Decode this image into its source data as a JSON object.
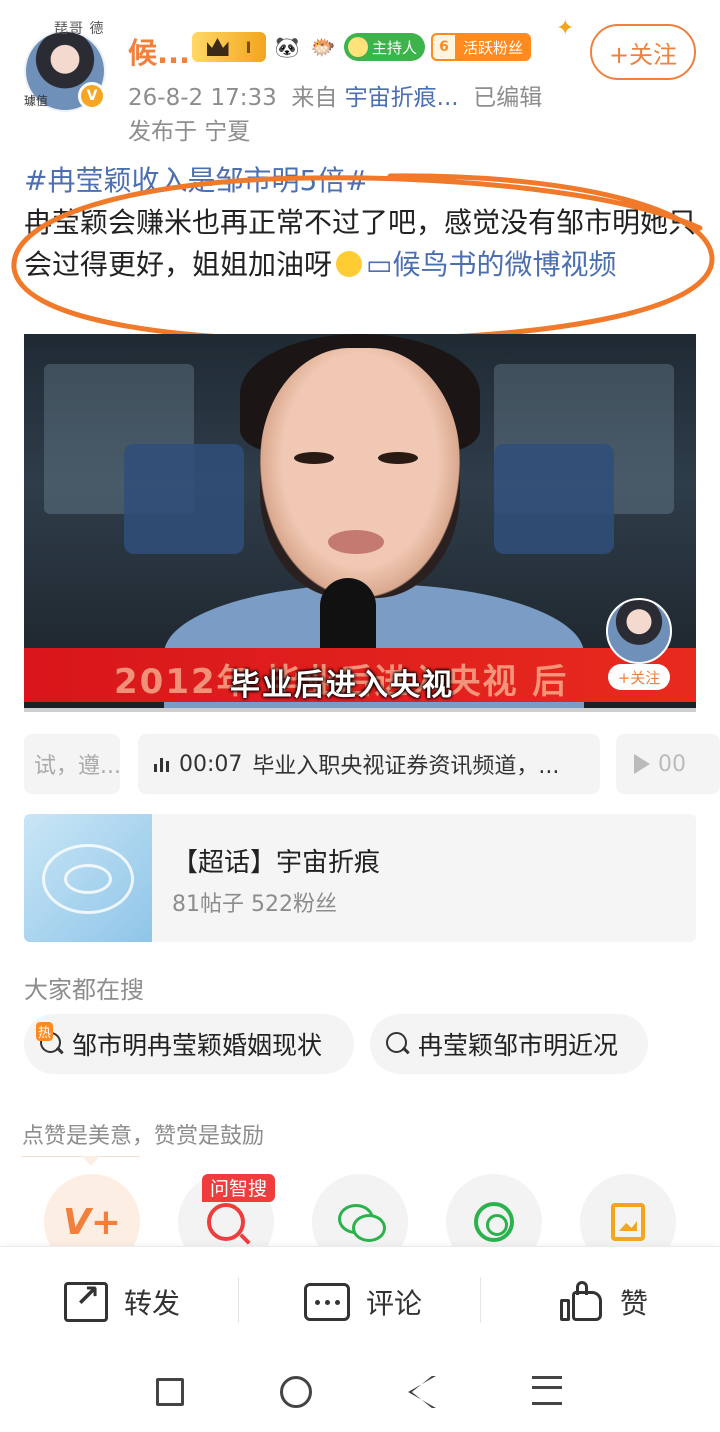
{
  "header": {
    "username": "候...",
    "avatar_tag_top": "琵哥 德",
    "avatar_tag_bottom": "璩值",
    "vip_level": "I",
    "host_badge": "主持人",
    "fan_level": "6",
    "fan_badge": "活跃粉丝",
    "follow_label": "+关注",
    "timestamp": "26-8-2 17:33",
    "from_prefix": "来自",
    "source": "宇宙折痕...",
    "edited": "已编辑",
    "location": "发布于 宁夏"
  },
  "post": {
    "topic": "#冉莹颖收入是邹市明5倍#",
    "body": "冉莹颖会赚米也再正常不过了吧，感觉没有邹市明她只会过得更好，姐姐加油呀",
    "video_link": "候鸟书的微博视频"
  },
  "video": {
    "banner_text": "2012年 毕业后进入央视 后",
    "subtitle": "毕业后进入央视",
    "follow_label": "+关注"
  },
  "video_chips": {
    "left": "试，遵...",
    "main_time": "00:07",
    "main_text": "毕业入职央视证券资讯频道，...",
    "right": "00"
  },
  "super_topic": {
    "title": "【超话】宇宙折痕",
    "stats": "81帖子 522粉丝"
  },
  "searching": {
    "heading": "大家都在搜",
    "hot_tag": "热",
    "items": [
      "邹市明冉莹颖婚姻现状",
      "冉莹颖邹市明近况"
    ]
  },
  "reward": {
    "text": "点赞是美意，赞赏是鼓励",
    "wen_tag": "问智搜"
  },
  "action_bar": {
    "share": "转发",
    "comment": "评论",
    "like": "赞"
  },
  "colors": {
    "accent_orange": "#f1803c",
    "link_blue": "#4c6fb0",
    "banner_red": "#d8161b",
    "wechat_green": "#2bb24c"
  },
  "icons": [
    "verified-icon",
    "crown-icon",
    "panda-icon",
    "fish-icon",
    "search-icon",
    "share-icon",
    "comment-icon",
    "like-icon"
  ]
}
